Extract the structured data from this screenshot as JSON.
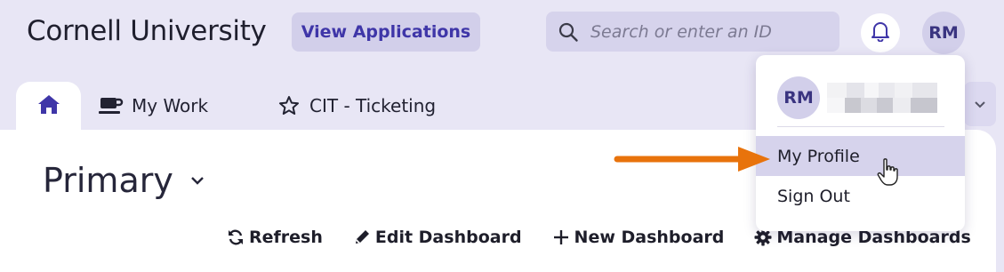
{
  "header": {
    "brand": "Cornell University",
    "view_apps_label": "View Applications",
    "search_placeholder": "Search or enter an ID",
    "avatar_initials": "RM",
    "icons": {
      "search": "search-icon",
      "bell": "bell-icon"
    }
  },
  "tabs": [
    {
      "label": "",
      "icon": "home-icon",
      "active": true
    },
    {
      "label": "My Work",
      "icon": "coffee-icon",
      "active": false
    },
    {
      "label": "CIT - Ticketing",
      "icon": "star-icon",
      "active": false
    }
  ],
  "dashboard": {
    "title": "Primary",
    "actions": [
      {
        "label": "Refresh",
        "icon": "refresh-icon"
      },
      {
        "label": "Edit Dashboard",
        "icon": "pencil-icon"
      },
      {
        "label": "New Dashboard",
        "icon": "plus-icon"
      },
      {
        "label": "Manage Dashboards",
        "icon": "gear-icon"
      }
    ]
  },
  "user_menu": {
    "avatar_initials": "RM",
    "items": [
      {
        "label": "My Profile",
        "highlighted": true
      },
      {
        "label": "Sign Out",
        "highlighted": false
      }
    ]
  },
  "colors": {
    "page_bg": "#e8e6f5",
    "accent": "#3f36a8",
    "chip_bg": "#d2cfea",
    "arrow": "#e8730c"
  }
}
